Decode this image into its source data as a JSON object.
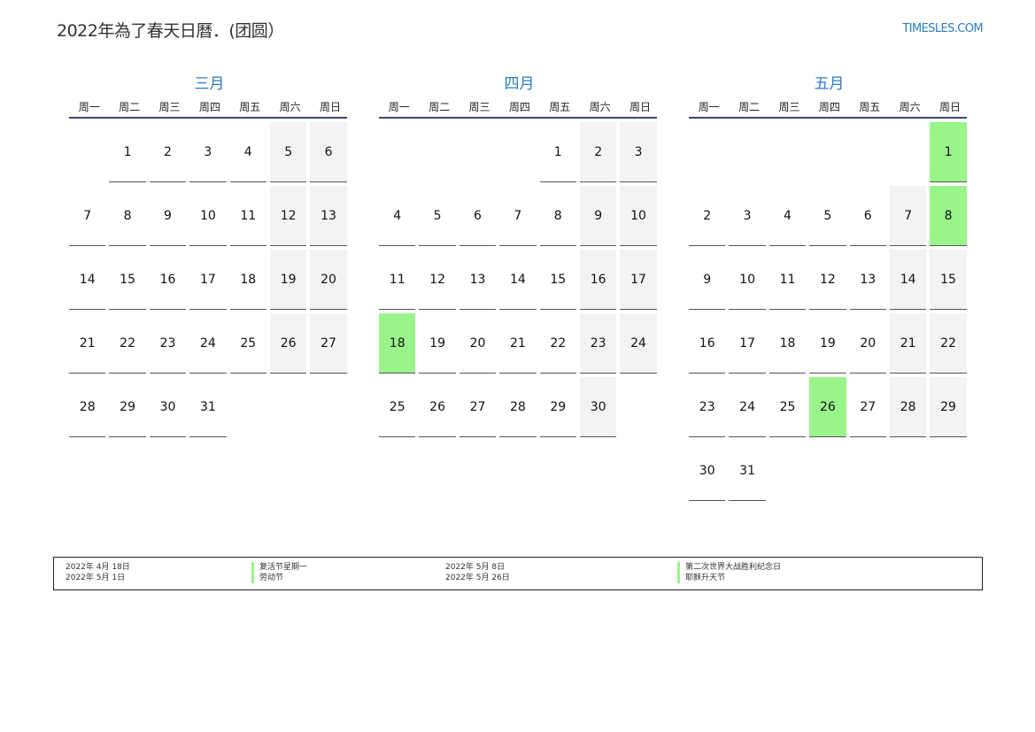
{
  "header": {
    "title": "2022年為了春天日曆．(团圆）",
    "site": "TIMESLES.COM"
  },
  "weekdays": [
    "周一",
    "周二",
    "周三",
    "周四",
    "周五",
    "周六",
    "周日"
  ],
  "months": [
    {
      "name": "三月",
      "offset": 1,
      "days": 31,
      "holidays": []
    },
    {
      "name": "四月",
      "offset": 4,
      "days": 30,
      "holidays": [
        18
      ]
    },
    {
      "name": "五月",
      "offset": 6,
      "days": 31,
      "holidays": [
        1,
        8,
        26
      ]
    }
  ],
  "legend": {
    "dates_left": [
      "2022年 4月 18日",
      "2022年 5月 1日"
    ],
    "names_left": [
      "复活节星期一",
      "劳动节"
    ],
    "dates_right": [
      "2022年 5月 8日",
      "2022年 5月 26日"
    ],
    "names_right": [
      "第二次世界大战胜利纪念日",
      "耶稣升天节"
    ]
  },
  "colors": {
    "holiday": "#99f58a",
    "weekend": "#f3f3f3",
    "accent": "#2e7cc4"
  }
}
